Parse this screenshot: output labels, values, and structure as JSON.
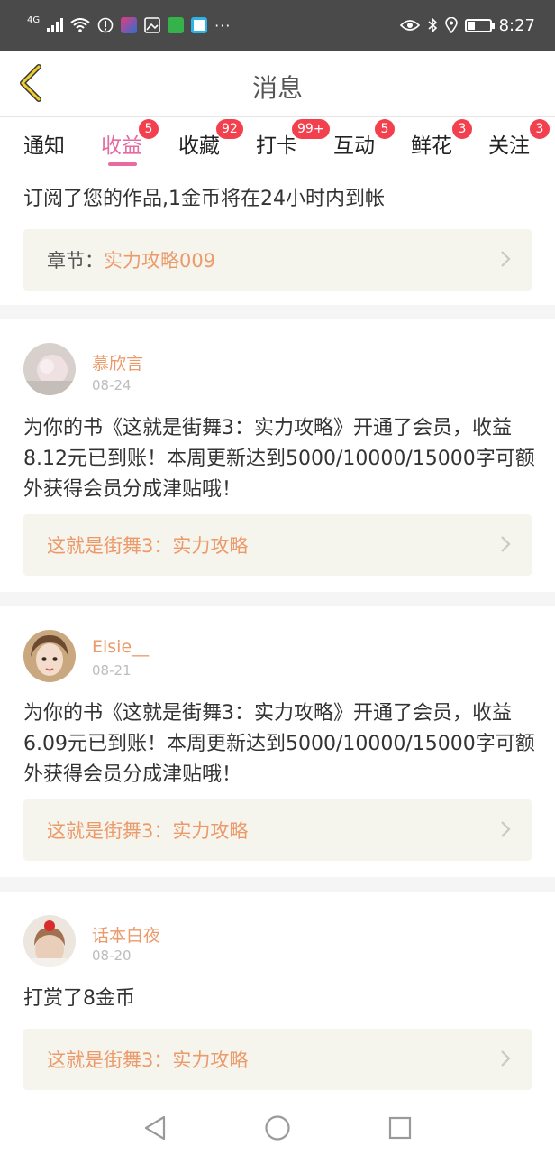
{
  "status_bar": {
    "network": "4G",
    "time": "8:27",
    "colors": {
      "bg": "#4a4a4a"
    },
    "icons": [
      "signal-icon",
      "wifi-icon",
      "alert-icon",
      "app-icon-1",
      "app-icon-2",
      "app-icon-3",
      "app-icon-4",
      "more-dots-icon",
      "eye-icon",
      "bluetooth-icon",
      "location-icon",
      "battery-icon"
    ],
    "overflow": "···"
  },
  "header": {
    "title": "消息",
    "back_icon": "chevron-left-icon"
  },
  "tabs": [
    {
      "label": "通知",
      "badge": ""
    },
    {
      "label": "收益",
      "badge": "5",
      "active": true
    },
    {
      "label": "收藏",
      "badge": "92"
    },
    {
      "label": "打卡",
      "badge": "99+"
    },
    {
      "label": "互动",
      "badge": "5"
    },
    {
      "label": "鲜花",
      "badge": "3"
    },
    {
      "label": "关注",
      "badge": "3"
    }
  ],
  "first_card": {
    "text": "订阅了您的作品,1金币将在24小时内到帐",
    "link_label": "章节：",
    "link_value": "实力攻略009"
  },
  "messages": [
    {
      "name": "慕欣言",
      "date": "08-24",
      "text": "为你的书《这就是街舞3：实力攻略》开通了会员，收益8.12元已到账！本周更新达到5000/10000/15000字可额外获得会员分成津贴哦！",
      "link": "这就是街舞3：实力攻略"
    },
    {
      "name": "Elsie__",
      "date": "08-21",
      "text": "为你的书《这就是街舞3：实力攻略》开通了会员，收益6.09元已到账！本周更新达到5000/10000/15000字可额外获得会员分成津贴哦！",
      "link": "这就是街舞3：实力攻略"
    },
    {
      "name": "话本白夜",
      "date": "08-20",
      "text": "打赏了8金币",
      "link": "这就是街舞3：实力攻略"
    }
  ],
  "colors": {
    "accent_pink": "#e36ba0",
    "badge_red": "#f2404e",
    "name_orange": "#ec9a6a",
    "link_bg": "#f5f4ed"
  },
  "nav_bar": [
    "back-triangle-icon",
    "home-circle-icon",
    "recents-square-icon"
  ]
}
